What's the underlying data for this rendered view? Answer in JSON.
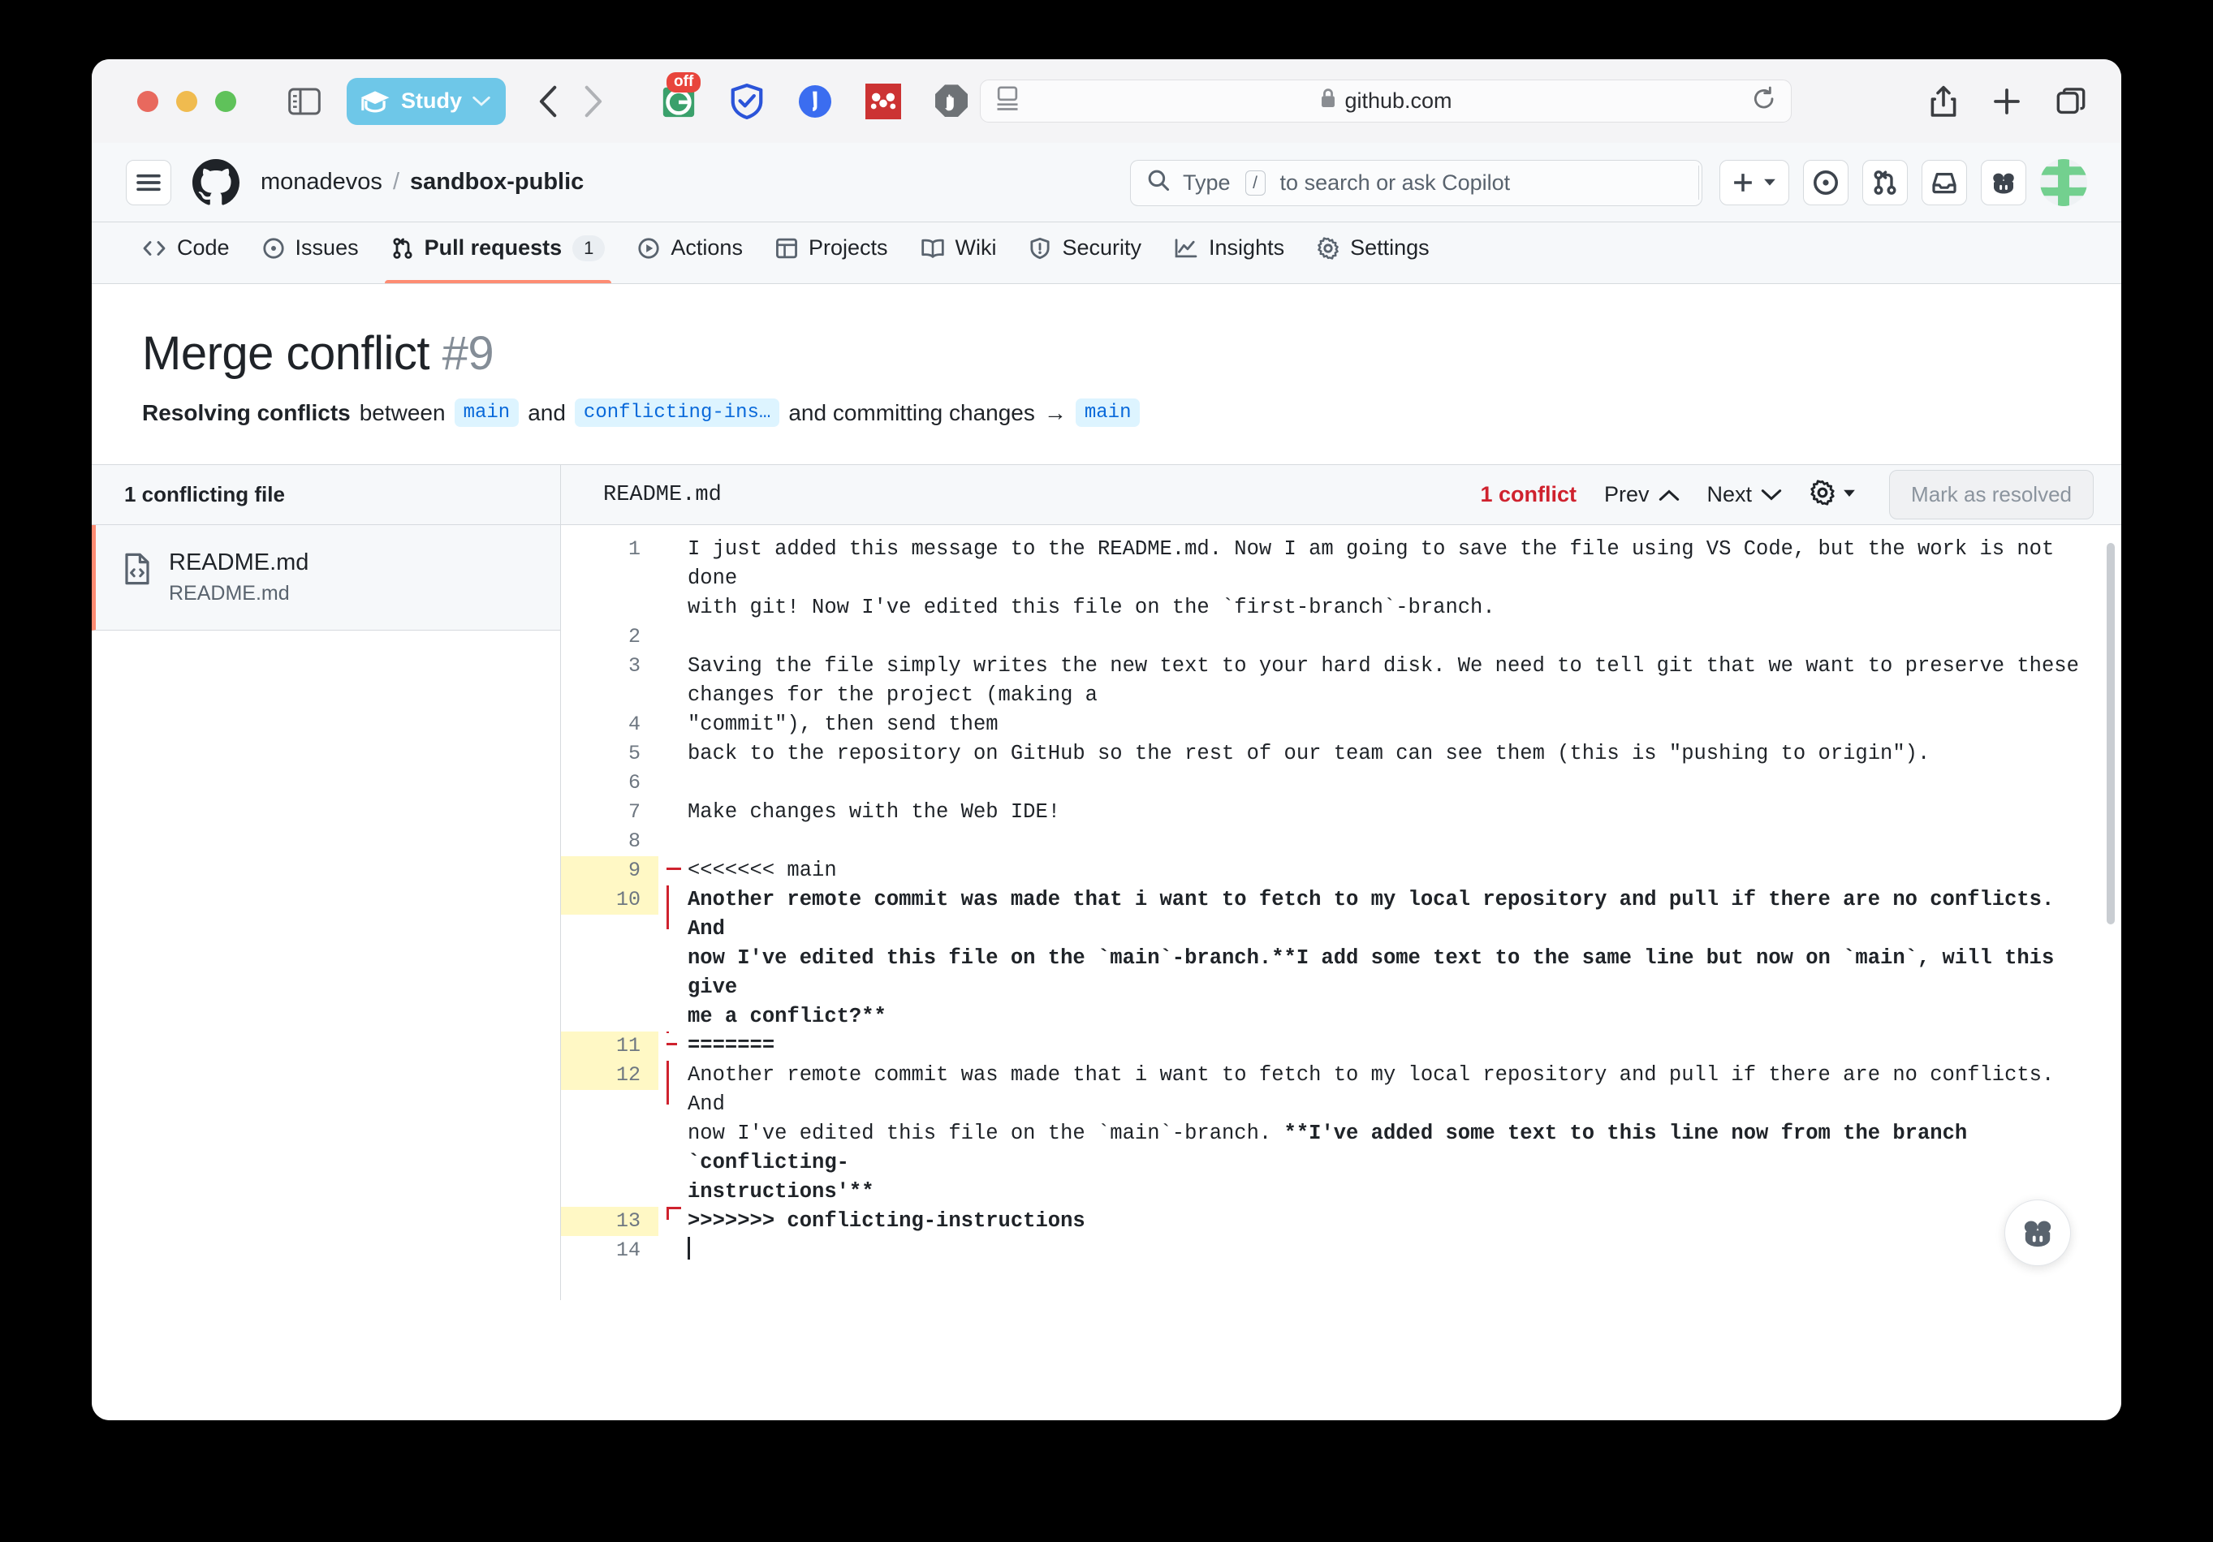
{
  "browser": {
    "profile_label": "Study",
    "url": "github.com",
    "extensions": [
      {
        "name": "grammarly-extension-icon",
        "badge": "off"
      },
      {
        "name": "adguard-extension-icon",
        "badge": ""
      },
      {
        "name": "lastpass-extension-icon",
        "badge": ""
      },
      {
        "name": "mendeley-extension-icon",
        "badge": ""
      },
      {
        "name": "adblock-extension-icon",
        "badge": ""
      }
    ]
  },
  "header": {
    "owner": "monadevos",
    "separator": "/",
    "repo": "sandbox-public",
    "search_placeholder_before": "Type",
    "search_slash_key": "/",
    "search_placeholder_after": "to search or ask Copilot"
  },
  "repo_nav": [
    {
      "label": "Code",
      "icon": "code-icon",
      "count": "",
      "active": false
    },
    {
      "label": "Issues",
      "icon": "issue-icon",
      "count": "",
      "active": false
    },
    {
      "label": "Pull requests",
      "icon": "pull-request-icon",
      "count": "1",
      "active": true
    },
    {
      "label": "Actions",
      "icon": "play-icon",
      "count": "",
      "active": false
    },
    {
      "label": "Projects",
      "icon": "table-icon",
      "count": "",
      "active": false
    },
    {
      "label": "Wiki",
      "icon": "book-icon",
      "count": "",
      "active": false
    },
    {
      "label": "Security",
      "icon": "shield-icon",
      "count": "",
      "active": false
    },
    {
      "label": "Insights",
      "icon": "graph-icon",
      "count": "",
      "active": false
    },
    {
      "label": "Settings",
      "icon": "gear-icon",
      "count": "",
      "active": false
    }
  ],
  "title": {
    "text": "Merge conflict ",
    "number": "#9"
  },
  "subtitle": {
    "lead": "Resolving conflicts",
    "between": "between",
    "base_branch": "main",
    "and": "and",
    "head_branch": "conflicting-ins…",
    "committing": "and committing changes",
    "arrow": "→",
    "target_branch": "main"
  },
  "sidebar": {
    "heading": "1 conflicting file",
    "files": [
      {
        "name": "README.md",
        "path": "README.md"
      }
    ]
  },
  "editor": {
    "filename": "README.md",
    "conflict_count": "1 conflict",
    "prev_label": "Prev",
    "next_label": "Next",
    "mark_resolved_label": "Mark as resolved",
    "lines": [
      {
        "n": "1",
        "html": "I just added this message to the README.md. Now I am going to save the file using VS Code, but the work is not done\nwith git! Now I've edited this file on the `first-branch`-branch.",
        "hl": false,
        "bracket": ""
      },
      {
        "n": "2",
        "html": "",
        "hl": false,
        "bracket": ""
      },
      {
        "n": "3",
        "html": "Saving the file simply writes the new text to your hard disk. We need to tell git that we want to preserve these\nchanges for the project (making a",
        "hl": false,
        "bracket": ""
      },
      {
        "n": "4",
        "html": "\"commit\"), then send them",
        "hl": false,
        "bracket": ""
      },
      {
        "n": "5",
        "html": "back to the repository on GitHub so the rest of our team can see them (this is \"pushing to origin\").",
        "hl": false,
        "bracket": ""
      },
      {
        "n": "6",
        "html": "",
        "hl": false,
        "bracket": ""
      },
      {
        "n": "7",
        "html": "Make changes with the Web IDE!",
        "hl": false,
        "bracket": ""
      },
      {
        "n": "8",
        "html": "",
        "hl": false,
        "bracket": ""
      },
      {
        "n": "9",
        "html": "<<<<<<< main",
        "hl": true,
        "bracket": "top"
      },
      {
        "n": "10",
        "html": "<b>Another remote commit was made that i want to fetch to my local repository and pull if there are no conflicts. And\nnow I've edited this file on the `main`-branch.**I add some text to the same line but now on `main`, will this give\nme a conflict?**</b>",
        "hl": true,
        "bracket": "line"
      },
      {
        "n": "11",
        "html": "<b>=======</b>",
        "hl": true,
        "bracket": "mid"
      },
      {
        "n": "12",
        "html": "Another remote commit was made that i want to fetch to my local repository and pull if there are no conflicts. And\nnow I've edited this file on the `main`-branch. <b>**I've added some text to this line now from the branch `conflicting-\ninstructions'**</b>",
        "hl": true,
        "bracket": "line"
      },
      {
        "n": "13",
        "html": "<b>&gt;&gt;&gt;&gt;&gt;&gt;&gt; conflicting-instructions</b>",
        "hl": true,
        "bracket": "bot"
      },
      {
        "n": "14",
        "html": "<span class=\"caret\"></span>",
        "hl": false,
        "bracket": ""
      }
    ]
  }
}
